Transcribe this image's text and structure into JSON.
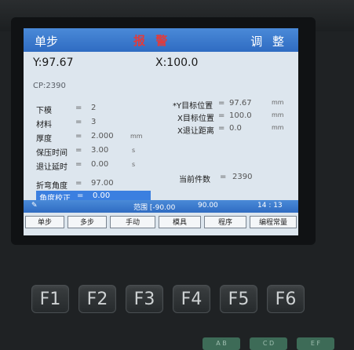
{
  "title_bar": {
    "mode": "单步",
    "alarm": "报 警",
    "adjust": "调 整"
  },
  "positions": {
    "y": "Y:97.67",
    "x": "X:100.0"
  },
  "cp": "CP:2390",
  "left_params": [
    {
      "label": "下模",
      "value": "2",
      "unit": ""
    },
    {
      "label": "材料",
      "value": "3",
      "unit": ""
    },
    {
      "label": "厚度",
      "value": "2.000",
      "unit": "mm"
    },
    {
      "label": "保压时间",
      "value": "3.00",
      "unit": "s"
    },
    {
      "label": "退让延时",
      "value": "0.00",
      "unit": "s"
    },
    {
      "label": "折弯角度",
      "value": "97.00",
      "unit": ""
    },
    {
      "label": "角度校正",
      "value": "0.00",
      "unit": ""
    }
  ],
  "right_params": [
    {
      "label": "*Y目标位置",
      "value": "97.67",
      "unit": "mm"
    },
    {
      "label": "X目标位置",
      "value": "100.0",
      "unit": "mm"
    },
    {
      "label": "X退让距离",
      "value": "0.0",
      "unit": "mm"
    }
  ],
  "piece_count": {
    "label": "当前件数",
    "value": "2390"
  },
  "status_bar": {
    "range": "范围 [-90.00",
    "range_end": "90.00",
    "time": "14 : 13"
  },
  "softkeys": [
    "单步",
    "多步",
    "手动",
    "模具",
    "程序",
    "编程常量"
  ],
  "fkeys": [
    "F1",
    "F2",
    "F3",
    "F4",
    "F5",
    "F6"
  ],
  "bottom_keys": [
    "A B",
    "C D",
    "E F"
  ]
}
